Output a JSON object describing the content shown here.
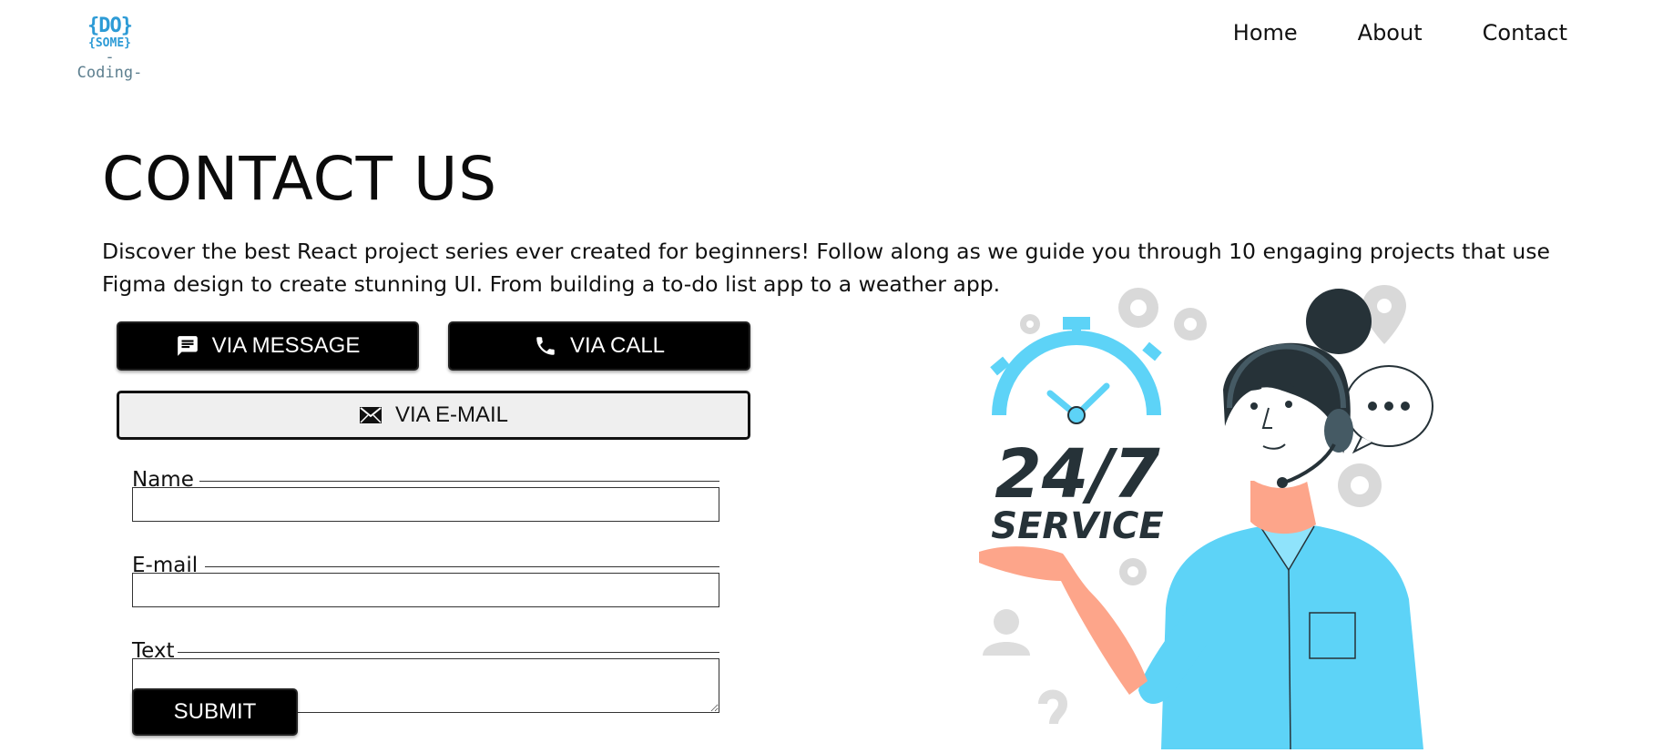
{
  "logo": {
    "line1": "{DO}",
    "line2": "{SOME}",
    "line3": "-Coding-"
  },
  "nav": {
    "items": [
      "Home",
      "About",
      "Contact"
    ]
  },
  "hero": {
    "title": "CONTACT US",
    "description": "Discover the best React project series ever created for beginners! Follow along as we guide you through 10 engaging projects that use Figma design to create stunning UI. From building a to-do list app to a weather app."
  },
  "buttons": {
    "message": {
      "label": "VIA MESSAGE",
      "icon": "chat-icon"
    },
    "call": {
      "label": "VIA CALL",
      "icon": "phone-icon"
    },
    "email": {
      "label": "VIA E-MAIL",
      "icon": "mail-icon"
    }
  },
  "form": {
    "name_label": "Name",
    "email_label": "E-mail",
    "text_label": "Text",
    "name_value": "",
    "email_value": "",
    "text_value": "",
    "submit_label": "SUBMIT"
  },
  "illustration": {
    "big_text": "24/7",
    "sub_text": "SERVICE",
    "accent_color": "#5dd3f7",
    "dark_color": "#263238"
  },
  "colors": {
    "button_dark": "#000000",
    "button_light": "#efefef",
    "text": "#111111"
  }
}
